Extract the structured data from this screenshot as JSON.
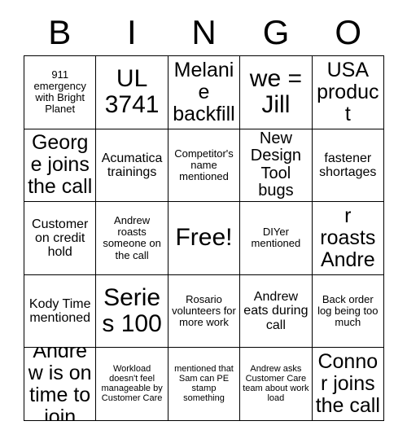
{
  "card": {
    "type": "bingo-card",
    "columns": 5,
    "rows": 5,
    "header": [
      "B",
      "I",
      "N",
      "G",
      "O"
    ],
    "cells": [
      {
        "text": "911 emergency with Bright Planet",
        "size": "sm",
        "free": false
      },
      {
        "text": "UL 3741",
        "size": "xxl",
        "free": false
      },
      {
        "text": "Melanie backfill",
        "size": "xl",
        "free": false
      },
      {
        "text": "we = Jill",
        "size": "xxl",
        "free": false
      },
      {
        "text": "USA product",
        "size": "xl",
        "free": false
      },
      {
        "text": "George joins the call",
        "size": "xl",
        "free": false
      },
      {
        "text": "Acumatica trainings",
        "size": "md",
        "free": false
      },
      {
        "text": "Competitor's name mentioned",
        "size": "sm",
        "free": false
      },
      {
        "text": "New Design Tool bugs",
        "size": "lg",
        "free": false
      },
      {
        "text": "fastener shortages",
        "size": "md",
        "free": false
      },
      {
        "text": "Customer on credit hold",
        "size": "md",
        "free": false
      },
      {
        "text": "Andrew roasts someone on the call",
        "size": "sm",
        "free": false
      },
      {
        "text": "Free!",
        "size": "xxl",
        "free": true
      },
      {
        "text": "DIYer mentioned",
        "size": "sm",
        "free": false
      },
      {
        "text": "Heather roasts Andrew",
        "size": "xl",
        "free": false
      },
      {
        "text": "Kody Time mentioned",
        "size": "md",
        "free": false
      },
      {
        "text": "Series 100",
        "size": "xxl",
        "free": false
      },
      {
        "text": "Rosario volunteers for more work",
        "size": "sm",
        "free": false
      },
      {
        "text": "Andrew eats during call",
        "size": "md",
        "free": false
      },
      {
        "text": "Back order log being too much",
        "size": "sm",
        "free": false
      },
      {
        "text": "Andrew is on time to join",
        "size": "xl",
        "free": false
      },
      {
        "text": "Workload doesn't feel manageable by Customer Care",
        "size": "xs",
        "free": false
      },
      {
        "text": "mentioned that Sam can PE stamp something",
        "size": "xs",
        "free": false
      },
      {
        "text": "Andrew asks Customer Care team about work load",
        "size": "xs",
        "free": false
      },
      {
        "text": "Connor joins the call",
        "size": "xl",
        "free": false
      }
    ]
  },
  "colors": {
    "background": "#ffffff",
    "text": "#000000",
    "border": "#000000"
  }
}
